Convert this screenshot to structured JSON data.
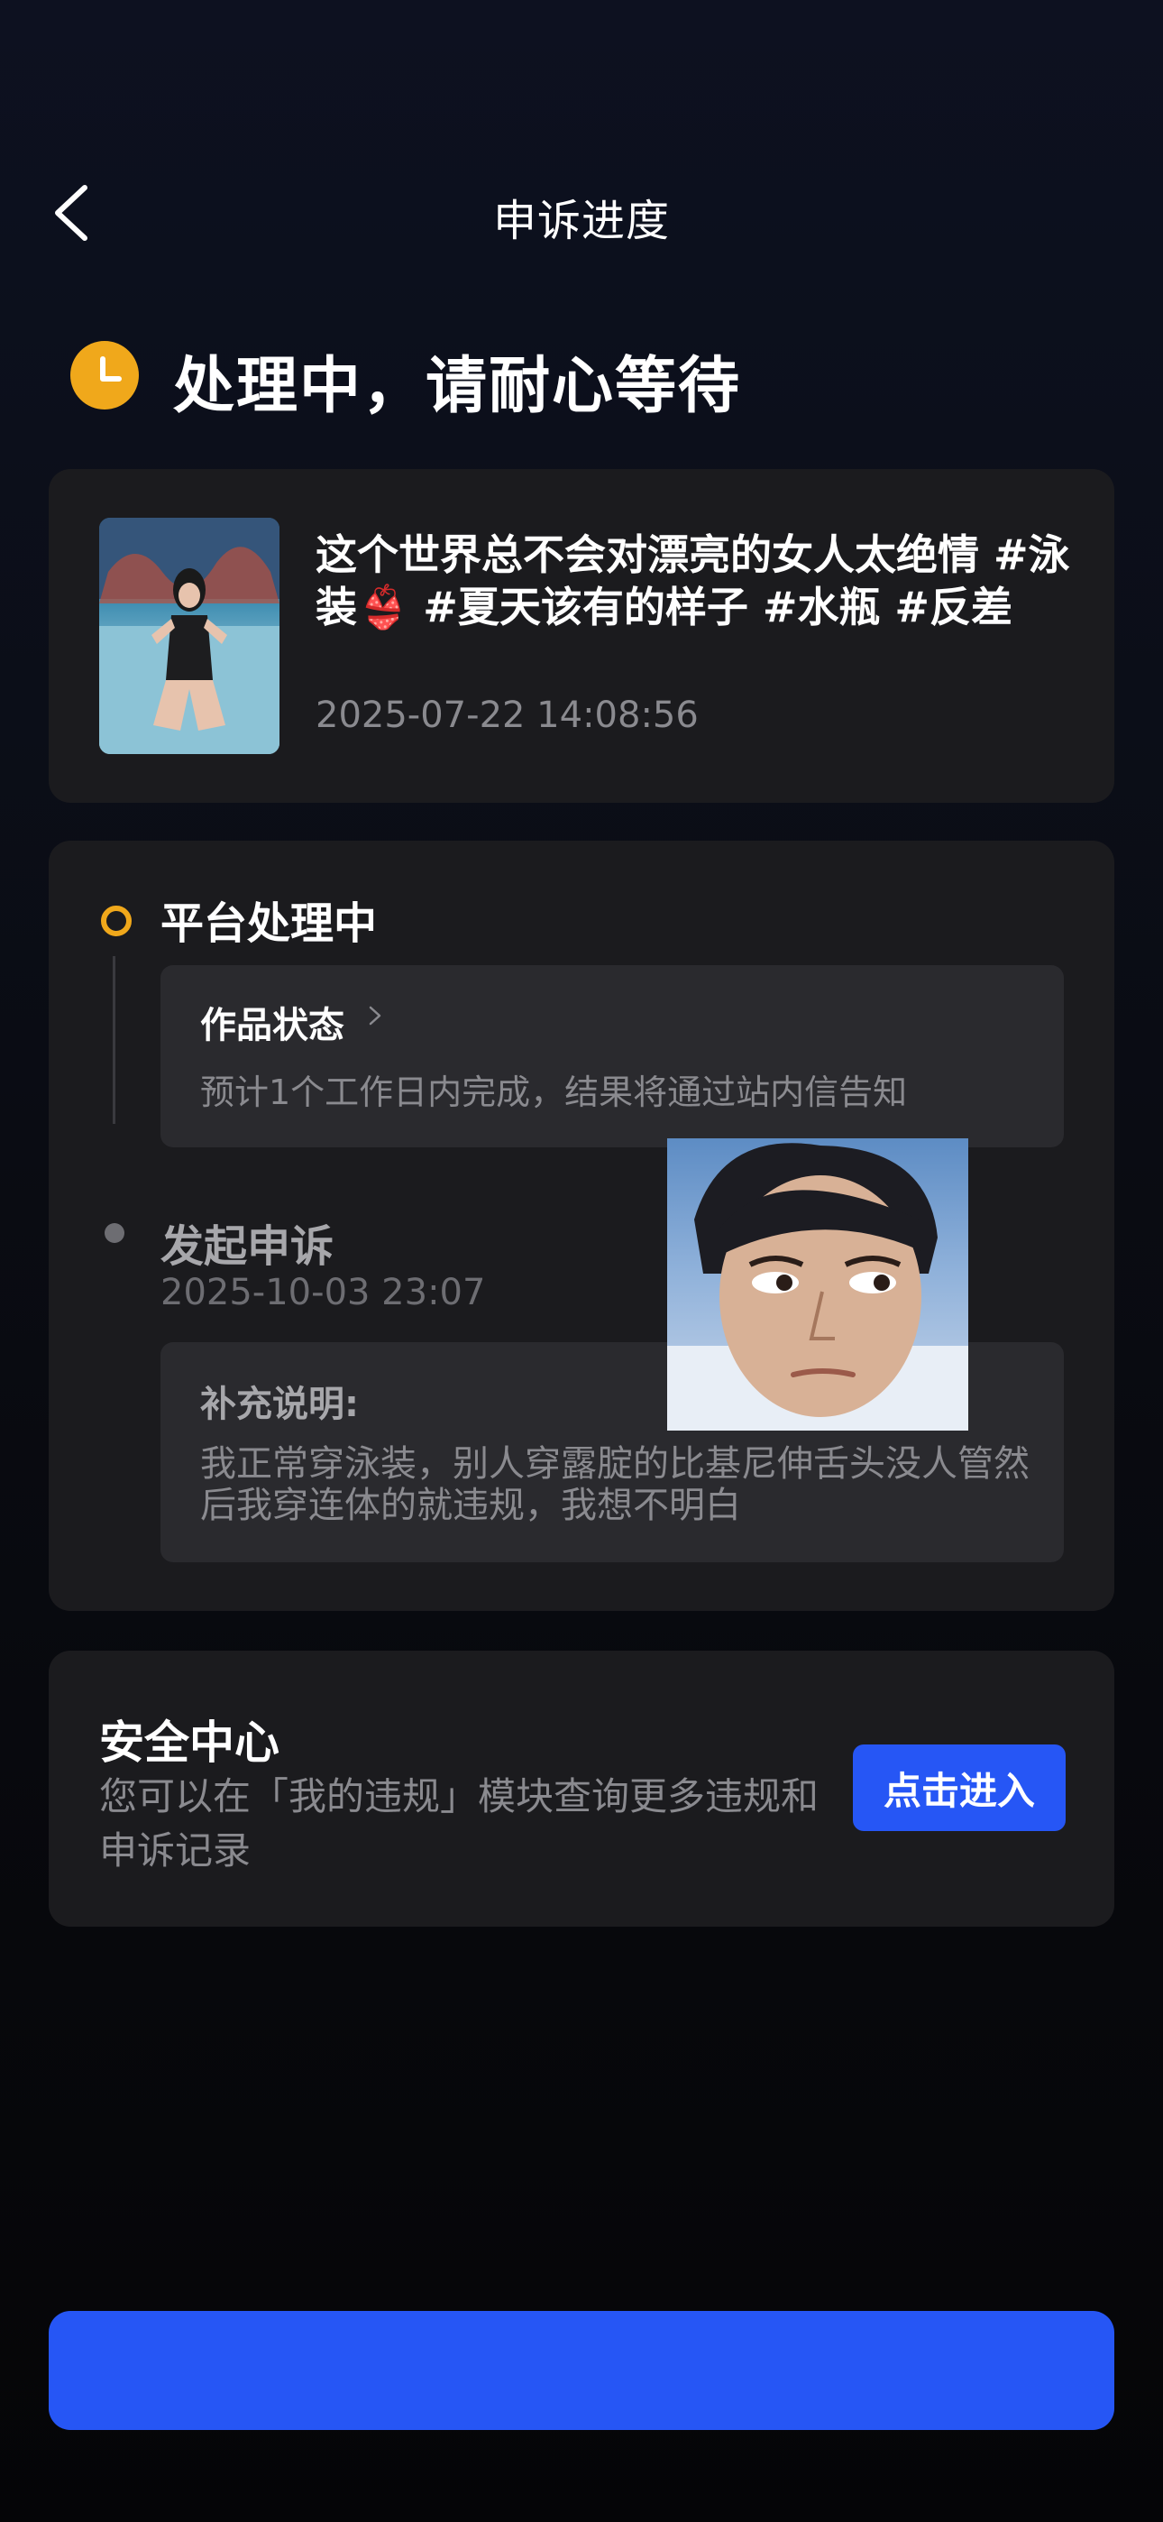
{
  "nav": {
    "title": "申诉进度",
    "back_icon": "chevron-left-icon"
  },
  "status_header": {
    "icon": "clock-icon",
    "icon_color": "#f0a81b",
    "text": "处理中，请耐心等待"
  },
  "video": {
    "caption": "这个世界总不会对漂亮的女人太绝情 #泳装👙 #夏天该有的样子 #水瓶 #反差",
    "date": "2025-07-22 14:08:56"
  },
  "progress": {
    "steps": [
      {
        "title": "平台处理中",
        "status": "current",
        "box_title": "作品状态",
        "box_desc": "预计1个工作日内完成，结果将通过站内信告知"
      },
      {
        "title": "发起申诉",
        "status": "done",
        "date": "2025-10-03 23:07",
        "note_title": "补充说明:",
        "note_text": "我正常穿泳装，别人穿露腚的比基尼伸舌头没人管然后我穿连体的就违规，我想不明白"
      }
    ]
  },
  "security": {
    "title": "安全中心",
    "desc": "您可以在「我的违规」模块查询更多违规和申诉记录",
    "button_label": "点击进入"
  },
  "bottom_button": {
    "label": ""
  },
  "colors": {
    "accent_blue": "#2656f5",
    "status_orange": "#f0a81b",
    "card_bg": "#1b1b1e"
  }
}
